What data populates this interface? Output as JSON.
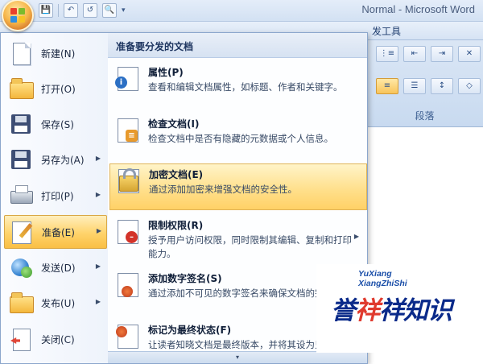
{
  "window": {
    "title": "Normal - Microsoft Word"
  },
  "quick_access": {
    "save": "💾",
    "undo": "↶",
    "redo": "↺",
    "preview": "🔍",
    "dropdown": "▾"
  },
  "ribbon": {
    "tab_partial": "发工具",
    "group_label": "段落"
  },
  "office_menu": {
    "left_items": [
      {
        "label": "新建(N)",
        "icon": "new-document-icon"
      },
      {
        "label": "打开(O)",
        "icon": "open-folder-icon"
      },
      {
        "label": "保存(S)",
        "icon": "save-floppy-icon"
      },
      {
        "label": "另存为(A)",
        "icon": "save-as-icon",
        "has_submenu": true
      },
      {
        "label": "打印(P)",
        "icon": "printer-icon",
        "has_submenu": true
      },
      {
        "label": "准备(E)",
        "icon": "prepare-pencil-icon",
        "has_submenu": true,
        "active": true
      },
      {
        "label": "发送(D)",
        "icon": "send-icon",
        "has_submenu": true
      },
      {
        "label": "发布(U)",
        "icon": "publish-icon",
        "has_submenu": true
      },
      {
        "label": "关闭(C)",
        "icon": "close-document-icon"
      }
    ],
    "submenu": {
      "header": "准备要分发的文档",
      "items": [
        {
          "title": "属性(P)",
          "desc": "查看和编辑文档属性，如标题、作者和关键字。",
          "icon": "properties-icon"
        },
        {
          "title": "检查文档(I)",
          "desc": "检查文档中是否有隐藏的元数据或个人信息。",
          "icon": "inspect-document-icon"
        },
        {
          "title": "加密文档(E)",
          "desc": "通过添加加密来增强文档的安全性。",
          "icon": "encrypt-lock-icon",
          "active": true
        },
        {
          "title": "限制权限(R)",
          "desc": "授予用户访问权限，同时限制其编辑、复制和打印能力。",
          "icon": "restrict-permission-icon",
          "has_submenu": true
        },
        {
          "title": "添加数字签名(S)",
          "desc": "通过添加不可见的数字签名来确保文档的完整性。",
          "icon": "digital-signature-icon"
        },
        {
          "title": "标记为最终状态(F)",
          "desc": "让读者知晓文档是最终版本，并将其设为只读。",
          "icon": "mark-final-icon"
        }
      ],
      "scroll_glyph": "▾"
    }
  },
  "watermark": {
    "sub1": "YuXiang",
    "sub2": "XiangZhiShi",
    "main_a": "誉",
    "main_b": "祥",
    "main_c": "祥知识"
  }
}
